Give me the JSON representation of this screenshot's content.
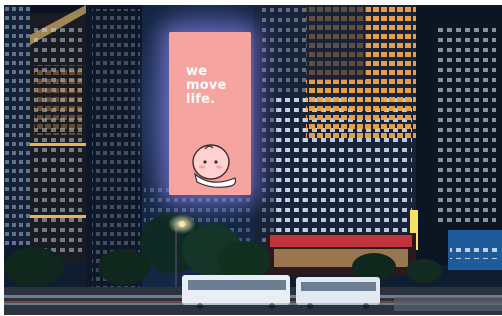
{
  "scene": {
    "billboard": {
      "headline": "we\nmove\nlife.",
      "background_color": "#f6a4a0",
      "text_color": "#ffffff",
      "mascot_icon": "peach-character-icon"
    },
    "colors": {
      "night_sky": "#0b1322",
      "warm_windows": "#f0a640",
      "cool_windows": "#d6e6f2",
      "street_lamp": "#ffe7a8",
      "red_awning": "#c0343c"
    }
  }
}
